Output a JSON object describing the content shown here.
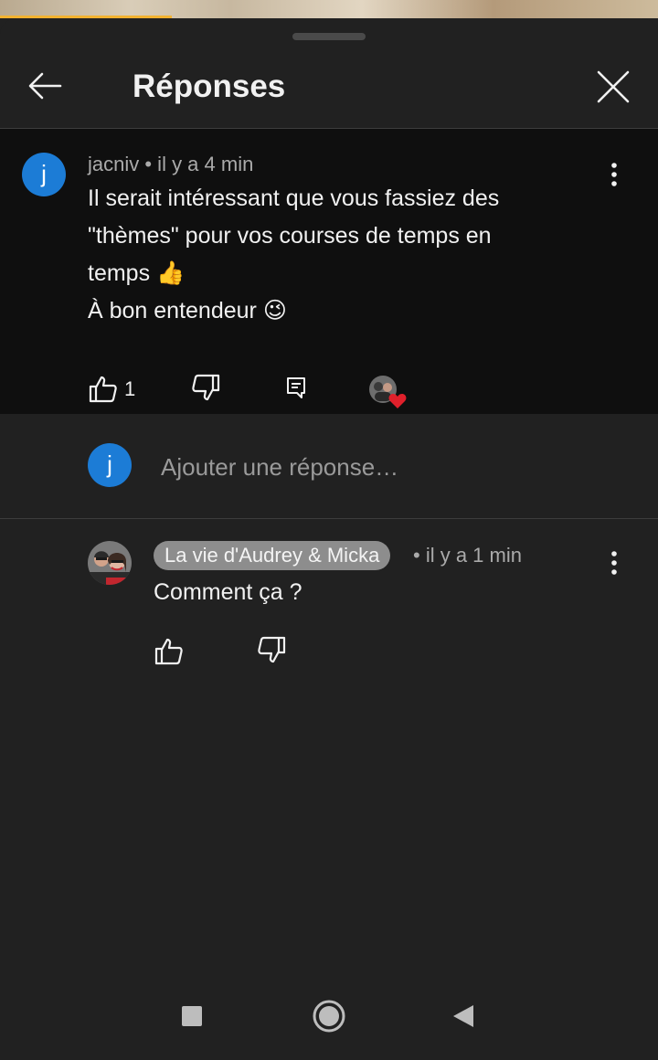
{
  "header": {
    "title": "Réponses"
  },
  "parent_comment": {
    "avatar_letter": "j",
    "author": "jacniv",
    "time": " • il y a 4 min",
    "lines": [
      "Il serait intéressant que vous fassiez des",
      "\"thèmes\" pour vos courses de temps en",
      "temps 👍",
      "À bon entendeur 😉"
    ],
    "like_count": "1"
  },
  "reply_input": {
    "avatar_letter": "j",
    "placeholder": "Ajouter une réponse…"
  },
  "reply": {
    "author": "La vie d'Audrey & Micka",
    "time": "• il y a 1 min",
    "text": "Comment ça ?"
  },
  "icons": {
    "back": "arrow-left-icon",
    "close": "close-icon",
    "more": "more-vert-icon",
    "like": "thumb-up-icon",
    "dislike": "thumb-down-icon",
    "reply": "reply-icon",
    "creator_heart": "creator-heart-icon",
    "nav_recent": "square-icon",
    "nav_home": "circle-icon",
    "nav_back": "triangle-back-icon"
  },
  "colors": {
    "background": "#212121",
    "parent_background": "#0f0f0f",
    "avatar_blue": "#1c7cd6",
    "author_chip": "#8d8d8d",
    "heart": "#e0202b"
  }
}
